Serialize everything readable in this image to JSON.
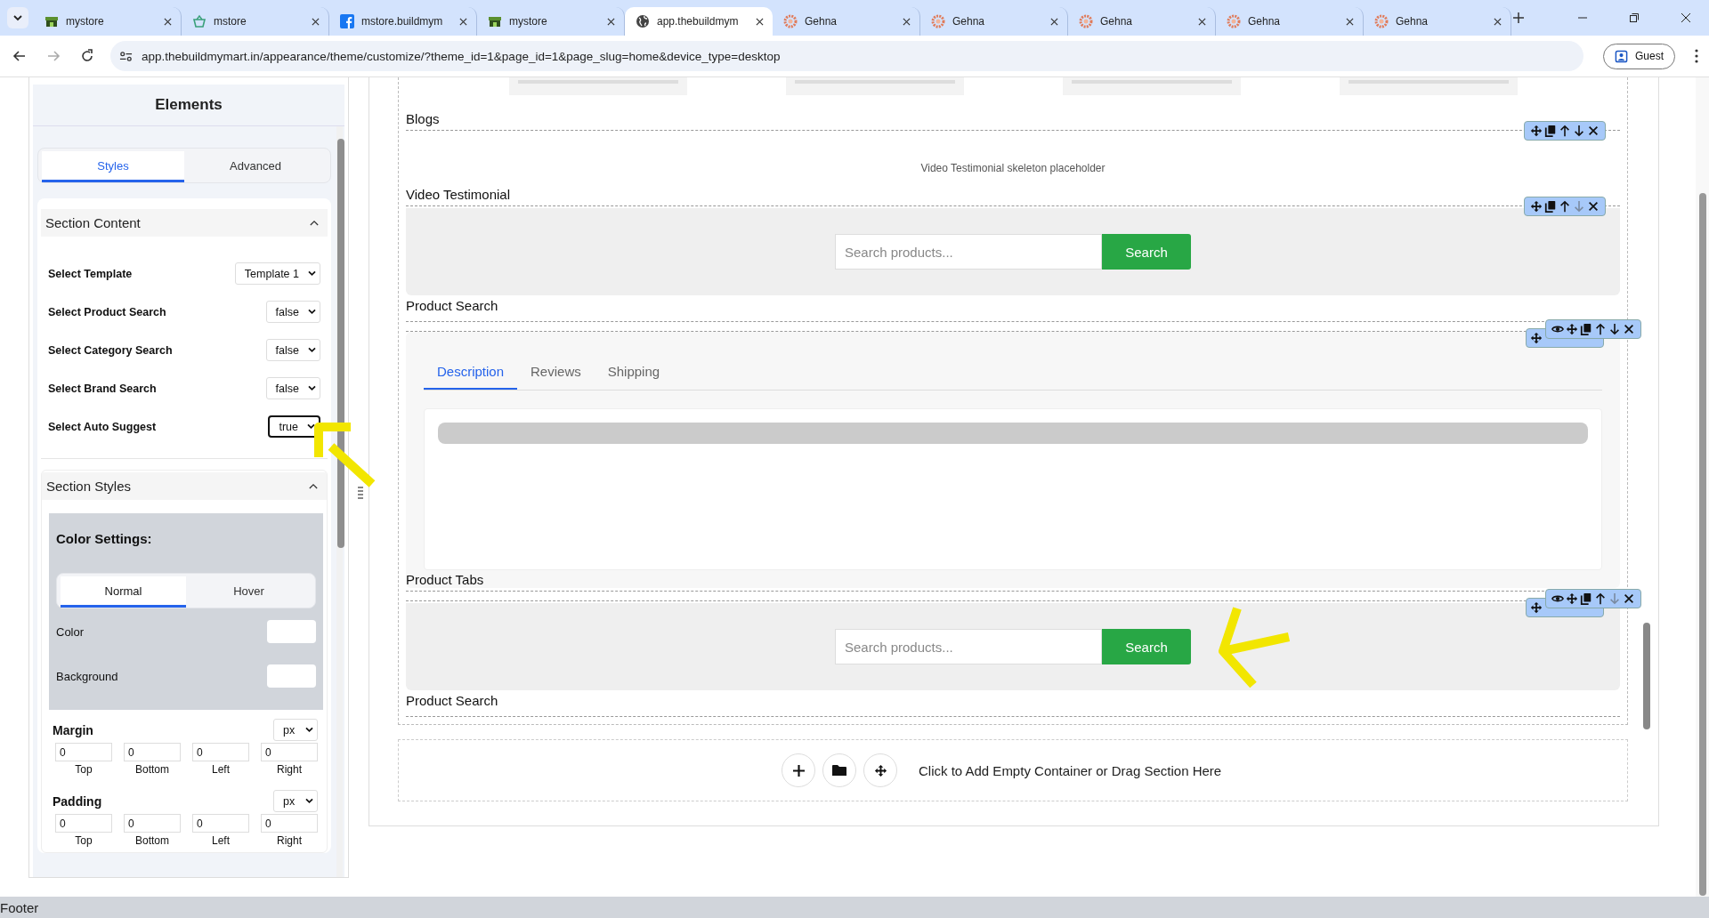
{
  "browser": {
    "tabs": [
      {
        "title": "mystore",
        "kind": "store",
        "selected": false
      },
      {
        "title": "mstore",
        "kind": "basket",
        "selected": false
      },
      {
        "title": "mstore.buildmym",
        "kind": "social",
        "selected": false
      },
      {
        "title": "mystore",
        "kind": "store",
        "selected": false
      },
      {
        "title": "app.thebuildmym",
        "kind": "globe",
        "selected": true
      },
      {
        "title": "Gehna",
        "kind": "gear",
        "selected": false
      },
      {
        "title": "Gehna",
        "kind": "gear",
        "selected": false
      },
      {
        "title": "Gehna",
        "kind": "gear",
        "selected": false
      },
      {
        "title": "Gehna",
        "kind": "gear",
        "selected": false
      },
      {
        "title": "Gehna",
        "kind": "gear",
        "selected": false
      }
    ],
    "url": "app.thebuildmymart.in/appearance/theme/customize/?theme_id=1&page_id=1&page_slug=home&device_type=desktop",
    "profile": "Guest"
  },
  "panel": {
    "title": "Elements",
    "tabs": [
      {
        "label": "Styles",
        "selected": true
      },
      {
        "label": "Advanced",
        "selected": false
      }
    ],
    "section_content": {
      "title": "Section Content",
      "expanded": true,
      "fields": [
        {
          "label": "Select Template",
          "value": "Template 1",
          "focused": false
        },
        {
          "label": "Select Product Search",
          "value": "false",
          "focused": false
        },
        {
          "label": "Select Category Search",
          "value": "false",
          "focused": false
        },
        {
          "label": "Select Brand Search",
          "value": "false",
          "focused": false
        },
        {
          "label": "Select Auto Suggest",
          "value": "true",
          "focused": true
        }
      ]
    },
    "section_styles": {
      "title": "Section Styles",
      "expanded": true,
      "color_settings": {
        "title": "Color Settings:",
        "tabs": [
          {
            "label": "Normal",
            "selected": true
          },
          {
            "label": "Hover",
            "selected": false
          }
        ],
        "fields": [
          {
            "label": "Color"
          },
          {
            "label": "Background"
          }
        ]
      },
      "spacing": [
        {
          "label": "Margin",
          "unit": "px",
          "values": [
            {
              "value": "0",
              "side": "Top"
            },
            {
              "value": "0",
              "side": "Bottom"
            },
            {
              "value": "0",
              "side": "Left"
            },
            {
              "value": "0",
              "side": "Right"
            }
          ]
        },
        {
          "label": "Padding",
          "unit": "px",
          "values": [
            {
              "value": "0",
              "side": "Top"
            },
            {
              "value": "0",
              "side": "Bottom"
            },
            {
              "value": "0",
              "side": "Left"
            },
            {
              "value": "0",
              "side": "Right"
            }
          ]
        }
      ]
    }
  },
  "canvas": {
    "sections": [
      {
        "kind": "skeleton_cards",
        "label": "Blogs",
        "toolbar": [
          {
            "kind": "move",
            "disabled": false
          },
          {
            "kind": "copy",
            "disabled": false
          },
          {
            "kind": "up",
            "disabled": false
          },
          {
            "kind": "down",
            "disabled": false
          },
          {
            "kind": "close",
            "disabled": false
          }
        ]
      },
      {
        "kind": "placeholder",
        "text": "Video Testimonial skeleton placeholder",
        "label": "Video Testimonial",
        "toolbar": [
          {
            "kind": "move",
            "disabled": false
          },
          {
            "kind": "copy",
            "disabled": false
          },
          {
            "kind": "up",
            "disabled": false
          },
          {
            "kind": "down",
            "disabled": true
          },
          {
            "kind": "close",
            "disabled": false
          }
        ]
      },
      {
        "kind": "search",
        "placeholder": "Search products...",
        "button": "Search",
        "label": "Product Search"
      },
      {
        "kind": "tabs",
        "tabs": [
          {
            "label": "Description",
            "selected": true
          },
          {
            "label": "Reviews",
            "selected": false
          },
          {
            "label": "Shipping",
            "selected": false
          }
        ],
        "label": "Product Tabs",
        "toolbar": [
          {
            "kind": "eye",
            "disabled": false
          },
          {
            "kind": "move",
            "disabled": false
          },
          {
            "kind": "copy",
            "disabled": false
          },
          {
            "kind": "up",
            "disabled": false
          },
          {
            "kind": "down",
            "disabled": false
          },
          {
            "kind": "close",
            "disabled": false
          }
        ]
      },
      {
        "kind": "search",
        "placeholder": "Search products...",
        "button": "Search",
        "label": "Product Search",
        "toolbar": [
          {
            "kind": "eye",
            "disabled": false
          },
          {
            "kind": "move",
            "disabled": false
          },
          {
            "kind": "copy",
            "disabled": false
          },
          {
            "kind": "up",
            "disabled": false
          },
          {
            "kind": "down",
            "disabled": true
          },
          {
            "kind": "close",
            "disabled": false
          }
        ]
      }
    ],
    "add_container": "Click to Add Empty Container or Drag Section Here"
  },
  "footer": "Footer"
}
